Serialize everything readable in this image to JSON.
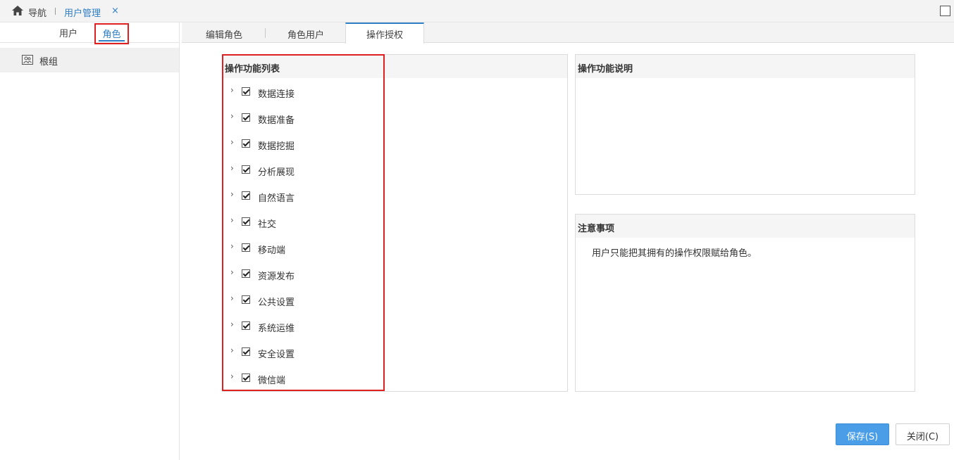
{
  "topbar": {
    "nav_label": "导航",
    "tab_label": "用户管理",
    "tab_close": "×"
  },
  "left_panel": {
    "tabs": [
      "用户",
      "角色"
    ],
    "active_tab": "角色",
    "tree_items": [
      {
        "label": "根组"
      }
    ]
  },
  "subtabs": [
    {
      "label": "编辑角色",
      "active": false
    },
    {
      "label": "角色用户",
      "active": false
    },
    {
      "label": "操作授权",
      "active": true
    }
  ],
  "function_list": {
    "title": "操作功能列表",
    "items": [
      {
        "label": "数据连接",
        "checked": true
      },
      {
        "label": "数据准备",
        "checked": true
      },
      {
        "label": "数据挖掘",
        "checked": true
      },
      {
        "label": "分析展现",
        "checked": true
      },
      {
        "label": "自然语言",
        "checked": true
      },
      {
        "label": "社交",
        "checked": true
      },
      {
        "label": "移动端",
        "checked": true
      },
      {
        "label": "资源发布",
        "checked": true
      },
      {
        "label": "公共设置",
        "checked": true
      },
      {
        "label": "系统运维",
        "checked": true
      },
      {
        "label": "安全设置",
        "checked": true
      },
      {
        "label": "微信端",
        "checked": true
      }
    ]
  },
  "description_panel": {
    "title": "操作功能说明"
  },
  "notes_panel": {
    "title": "注意事项",
    "text": "用户只能把其拥有的操作权限赋给角色。"
  },
  "buttons": {
    "save": "保存(S)",
    "close": "关闭(C)"
  },
  "colors": {
    "accent": "#2f7fc6",
    "primary_button": "#4a9ee8",
    "highlight_border": "#e02020"
  },
  "icons": {
    "home": "home-icon",
    "group": "group-icon",
    "chevron": "chevron-right-icon",
    "checkbox": "checkbox-checked-icon",
    "restore": "maximize-icon"
  }
}
